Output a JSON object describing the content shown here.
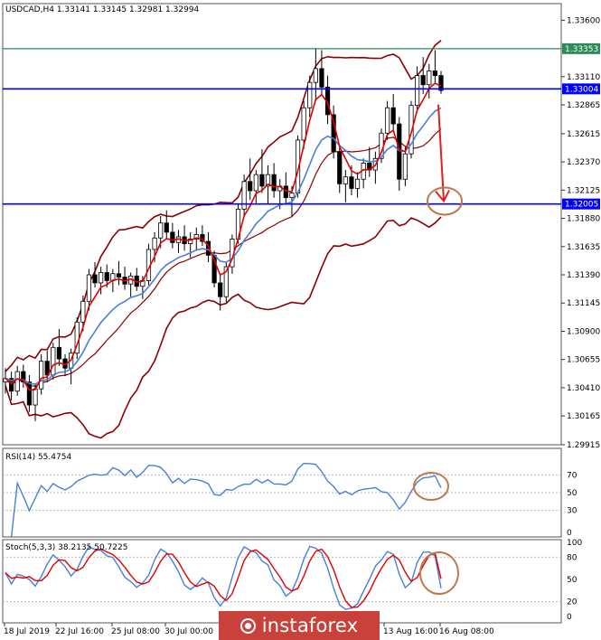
{
  "chart_data": {
    "type": "candlestick",
    "symbol_header": "USDCAD,H4  1.33141 1.33145 1.32981 1.32994",
    "price_axis": {
      "min": 1.29915,
      "max": 1.3365,
      "ticks": [
        "1.33600",
        "1.33110",
        "1.32865",
        "1.32615",
        "1.32370",
        "1.32125",
        "1.31880",
        "1.31635",
        "1.31390",
        "1.31145",
        "1.30900",
        "1.30655",
        "1.30410",
        "1.30165",
        "1.29915"
      ]
    },
    "levels": [
      {
        "label": "1.33353",
        "value": 1.33353,
        "color": "#2e8b57"
      },
      {
        "label": "1.33004",
        "value": 1.33004,
        "color": "#0000ff"
      },
      {
        "label": "1.32005",
        "value": 1.32005,
        "color": "#0000ff"
      }
    ],
    "candles": [
      [
        1.3046,
        1.3058,
        1.3036,
        1.3049
      ],
      [
        1.3049,
        1.3055,
        1.303,
        1.3038
      ],
      [
        1.3038,
        1.306,
        1.3034,
        1.3055
      ],
      [
        1.3055,
        1.3061,
        1.3041,
        1.3046
      ],
      [
        1.3046,
        1.3052,
        1.302,
        1.3026
      ],
      [
        1.3026,
        1.3045,
        1.3012,
        1.304
      ],
      [
        1.304,
        1.307,
        1.3035,
        1.3064
      ],
      [
        1.3064,
        1.3073,
        1.3046,
        1.3052
      ],
      [
        1.3052,
        1.308,
        1.3048,
        1.3076
      ],
      [
        1.3076,
        1.3092,
        1.306,
        1.3066
      ],
      [
        1.3066,
        1.307,
        1.3051,
        1.3058
      ],
      [
        1.3058,
        1.3075,
        1.3044,
        1.3071
      ],
      [
        1.3071,
        1.3102,
        1.3066,
        1.3098
      ],
      [
        1.3098,
        1.3121,
        1.309,
        1.3116
      ],
      [
        1.3116,
        1.3144,
        1.3108,
        1.3139
      ],
      [
        1.3139,
        1.315,
        1.3128,
        1.3132
      ],
      [
        1.3132,
        1.3146,
        1.3122,
        1.3141
      ],
      [
        1.3141,
        1.3148,
        1.3128,
        1.3134
      ],
      [
        1.3134,
        1.3144,
        1.3124,
        1.314
      ],
      [
        1.314,
        1.3151,
        1.313,
        1.3137
      ],
      [
        1.3137,
        1.3146,
        1.3126,
        1.3131
      ],
      [
        1.3131,
        1.3141,
        1.312,
        1.3138
      ],
      [
        1.3138,
        1.3145,
        1.3125,
        1.3129
      ],
      [
        1.3129,
        1.3138,
        1.3118,
        1.3134
      ],
      [
        1.3134,
        1.3166,
        1.313,
        1.3161
      ],
      [
        1.3161,
        1.3176,
        1.315,
        1.3171
      ],
      [
        1.3171,
        1.319,
        1.3162,
        1.3184
      ],
      [
        1.3184,
        1.3195,
        1.317,
        1.3176
      ],
      [
        1.3176,
        1.3184,
        1.3162,
        1.3167
      ],
      [
        1.3167,
        1.3178,
        1.3158,
        1.3172
      ],
      [
        1.3172,
        1.3182,
        1.316,
        1.3166
      ],
      [
        1.3166,
        1.3176,
        1.3154,
        1.317
      ],
      [
        1.317,
        1.318,
        1.316,
        1.3174
      ],
      [
        1.3174,
        1.3182,
        1.3164,
        1.3168
      ],
      [
        1.3168,
        1.3176,
        1.315,
        1.3156
      ],
      [
        1.3156,
        1.316,
        1.3128,
        1.3132
      ],
      [
        1.3132,
        1.314,
        1.3108,
        1.312
      ],
      [
        1.312,
        1.315,
        1.3115,
        1.3146
      ],
      [
        1.3146,
        1.3174,
        1.314,
        1.317
      ],
      [
        1.317,
        1.32,
        1.3166,
        1.3196
      ],
      [
        1.3196,
        1.3226,
        1.319,
        1.322
      ],
      [
        1.322,
        1.324,
        1.3204,
        1.3212
      ],
      [
        1.3212,
        1.323,
        1.32,
        1.3226
      ],
      [
        1.3226,
        1.3248,
        1.321,
        1.3216
      ],
      [
        1.3216,
        1.3234,
        1.32,
        1.3226
      ],
      [
        1.3226,
        1.3236,
        1.3206,
        1.3212
      ],
      [
        1.3212,
        1.3222,
        1.3196,
        1.3216
      ],
      [
        1.3216,
        1.3228,
        1.32,
        1.3206
      ],
      [
        1.3206,
        1.3216,
        1.319,
        1.321
      ],
      [
        1.321,
        1.326,
        1.3206,
        1.3256
      ],
      [
        1.3256,
        1.329,
        1.3248,
        1.3284
      ],
      [
        1.3284,
        1.3312,
        1.3276,
        1.3306
      ],
      [
        1.3306,
        1.3336,
        1.329,
        1.3318
      ],
      [
        1.3318,
        1.3334,
        1.3296,
        1.3302
      ],
      [
        1.3302,
        1.3312,
        1.327,
        1.3278
      ],
      [
        1.3278,
        1.3286,
        1.324,
        1.3246
      ],
      [
        1.3246,
        1.3252,
        1.321,
        1.3218
      ],
      [
        1.3218,
        1.323,
        1.3202,
        1.3224
      ],
      [
        1.3224,
        1.3234,
        1.3208,
        1.3214
      ],
      [
        1.3214,
        1.3228,
        1.3206,
        1.3222
      ],
      [
        1.3222,
        1.324,
        1.3214,
        1.3236
      ],
      [
        1.3236,
        1.325,
        1.3224,
        1.323
      ],
      [
        1.323,
        1.3246,
        1.3218,
        1.324
      ],
      [
        1.324,
        1.3266,
        1.3236,
        1.3262
      ],
      [
        1.3262,
        1.329,
        1.3256,
        1.3284
      ],
      [
        1.3284,
        1.3296,
        1.3264,
        1.327
      ],
      [
        1.327,
        1.3276,
        1.3212,
        1.3222
      ],
      [
        1.3222,
        1.325,
        1.3216,
        1.3244
      ],
      [
        1.3244,
        1.329,
        1.324,
        1.3286
      ],
      [
        1.3286,
        1.332,
        1.328,
        1.3312
      ],
      [
        1.3312,
        1.3328,
        1.3296,
        1.3304
      ],
      [
        1.3304,
        1.3322,
        1.3292,
        1.3316
      ],
      [
        1.3316,
        1.3334,
        1.3306,
        1.3312
      ],
      [
        1.3312,
        1.3316,
        1.3296,
        1.3299
      ]
    ],
    "series": [
      {
        "name": "EMA fast",
        "color": "#e00000"
      },
      {
        "name": "EMA slow",
        "color": "#4a7fd8"
      },
      {
        "name": "Bollinger Bands",
        "color": "#8b0000"
      }
    ],
    "time_labels": [
      "18 Jul 2019",
      "22 Jul 16:00",
      "25 Jul 08:00",
      "30 Jul 00:00",
      "13 Aug 16:00",
      "16 Aug 08:00"
    ],
    "forecast_arrow": {
      "from": 1.32868,
      "to": 1.3203
    },
    "rsi": {
      "label": "RSI(14) 55.4754",
      "value": 55.4754,
      "levels": [
        "70",
        "50",
        "30",
        "0"
      ]
    },
    "stoch": {
      "label": "Stoch(5,3,3) 38.2135 50.7225",
      "k": 38.2135,
      "d": 50.7225,
      "levels": [
        "100",
        "80",
        "50",
        "20",
        "0"
      ]
    },
    "watermark": "instaforex"
  }
}
